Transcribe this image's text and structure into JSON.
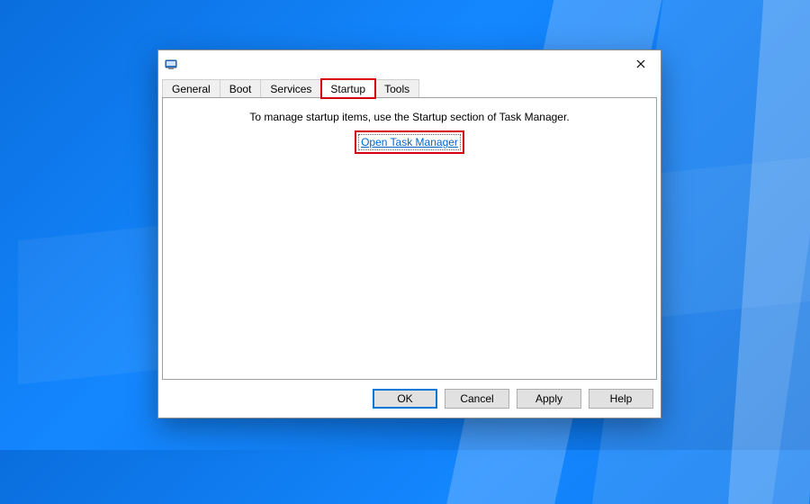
{
  "wallpaper": {
    "theme": "windows-10-blue"
  },
  "dialog": {
    "icon": "msconfig-icon"
  },
  "tabs": [
    {
      "label": "General"
    },
    {
      "label": "Boot"
    },
    {
      "label": "Services"
    },
    {
      "label": "Startup"
    },
    {
      "label": "Tools"
    }
  ],
  "active_tab_index": 3,
  "highlighted_tab_index": 3,
  "startup_panel": {
    "instruction": "To manage startup items, use the Startup section of Task Manager.",
    "link_label": "Open Task Manager"
  },
  "buttons": {
    "ok": "OK",
    "cancel": "Cancel",
    "apply": "Apply",
    "help": "Help"
  },
  "colors": {
    "highlight": "#d4000e",
    "link": "#0066cc",
    "default_button_border": "#0078d7"
  }
}
